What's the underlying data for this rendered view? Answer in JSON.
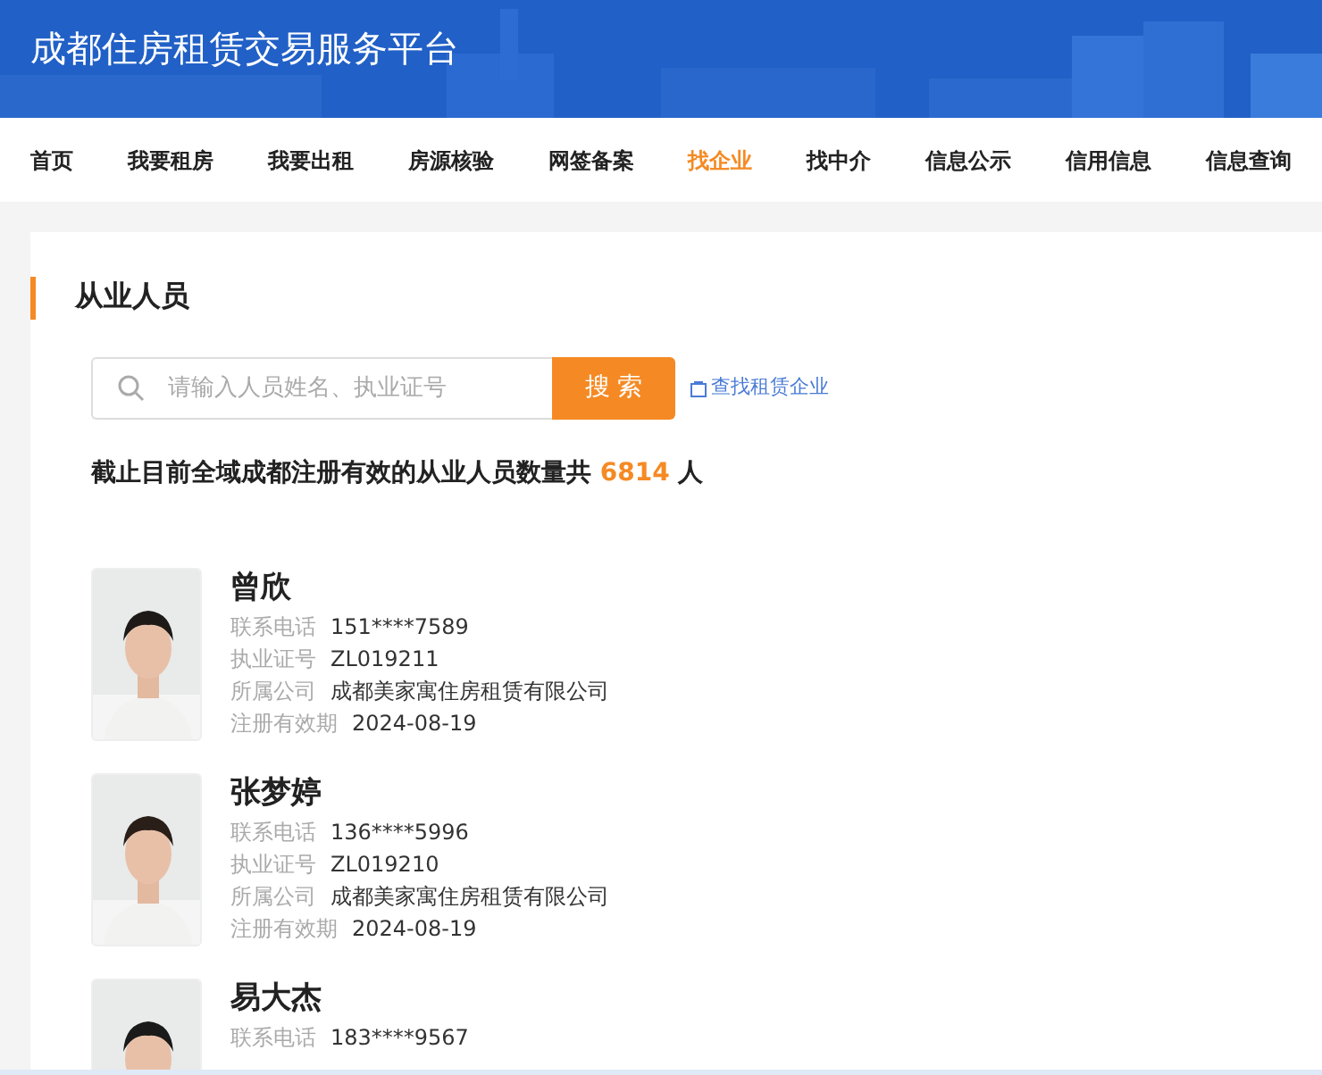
{
  "header": {
    "title": "成都住房租赁交易服务平台"
  },
  "nav": [
    {
      "label": "首页",
      "selected": false
    },
    {
      "label": "我要租房",
      "selected": false
    },
    {
      "label": "我要出租",
      "selected": false
    },
    {
      "label": "房源核验",
      "selected": false
    },
    {
      "label": "网签备案",
      "selected": false
    },
    {
      "label": "找企业",
      "selected": true
    },
    {
      "label": "找中介",
      "selected": false
    },
    {
      "label": "信息公示",
      "selected": false
    },
    {
      "label": "信用信息",
      "selected": false
    },
    {
      "label": "信息查询",
      "selected": false
    }
  ],
  "section": {
    "title": "从业人员"
  },
  "search": {
    "placeholder": "请输入人员姓名、执业证号",
    "button": "搜 索",
    "link": "查找租赁企业"
  },
  "summary": {
    "prefix": "截止目前全域成都注册有效的从业人员数量共",
    "count": "6814",
    "suffix": "人"
  },
  "people": [
    {
      "name": "曾欣",
      "fields": [
        {
          "label": "联系电话",
          "value": "151****7589"
        },
        {
          "label": "执业证号",
          "value": "ZL019211"
        },
        {
          "label": "所属公司",
          "value": "成都美家寓住房租赁有限公司"
        },
        {
          "label": "注册有效期",
          "value": "2024-08-19"
        }
      ]
    },
    {
      "name": "张梦婷",
      "fields": [
        {
          "label": "联系电话",
          "value": "136****5996"
        },
        {
          "label": "执业证号",
          "value": "ZL019210"
        },
        {
          "label": "所属公司",
          "value": "成都美家寓住房租赁有限公司"
        },
        {
          "label": "注册有效期",
          "value": "2024-08-19"
        }
      ]
    },
    {
      "name": "易大杰",
      "fields": [
        {
          "label": "联系电话",
          "value": "183****9567"
        }
      ]
    }
  ]
}
